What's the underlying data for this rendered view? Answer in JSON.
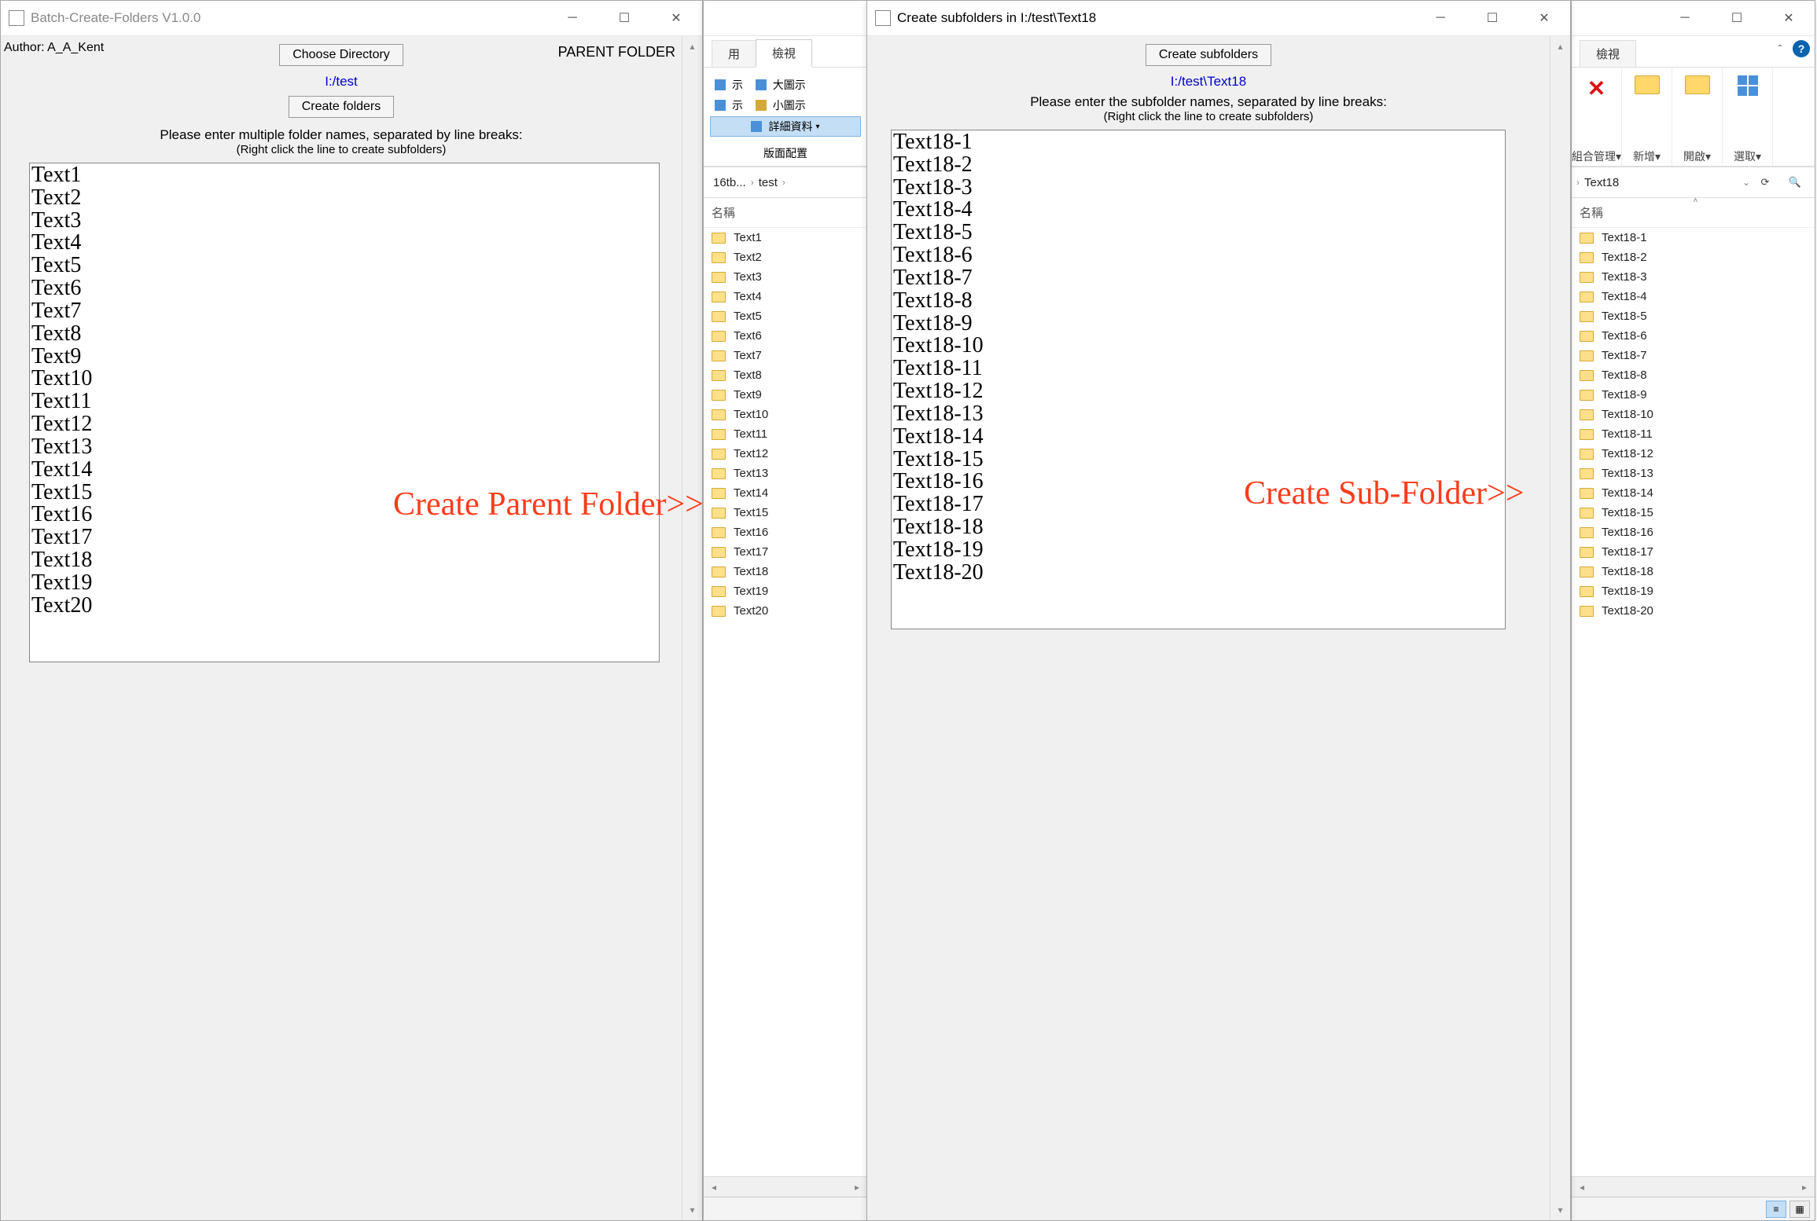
{
  "win1": {
    "title": "Batch-Create-Folders V1.0.0",
    "author": "Author: A_A_Kent",
    "parent_label": "PARENT FOLDER",
    "choose_dir": "Choose Directory",
    "path": "I:/test",
    "create_folders": "Create folders",
    "hint1": "Please enter multiple folder names, separated by line breaks:",
    "hint2": "(Right click the line to create subfolders)",
    "text": "Text1\nText2\nText3\nText4\nText5\nText6\nText7\nText8\nText9\nText10\nText11\nText12\nText13\nText14\nText15\nText16\nText17\nText18\nText19\nText20"
  },
  "win2": {
    "title": "Create subfolders in I:/test\\Text18",
    "create_sub": "Create subfolders",
    "path": "I:/test\\Text18",
    "hint1": "Please enter the subfolder names, separated by line breaks:",
    "hint2": "(Right click the line to create subfolders)",
    "text": "Text18-1\nText18-2\nText18-3\nText18-4\nText18-5\nText18-6\nText18-7\nText18-8\nText18-9\nText18-10\nText18-11\nText18-12\nText18-13\nText18-14\nText18-15\nText18-16\nText18-17\nText18-18\nText18-19\nText18-20"
  },
  "explorer1": {
    "tabs": {
      "a": "用",
      "b": "檢視"
    },
    "views": {
      "large": "大圖示",
      "small": "小圖示",
      "details": "詳細資料",
      "suffix": "示"
    },
    "panel": "版面配置",
    "bc_root": "16tb...",
    "bc_sub": "test",
    "col_name": "名稱",
    "folders": [
      "Text1",
      "Text2",
      "Text3",
      "Text4",
      "Text5",
      "Text6",
      "Text7",
      "Text8",
      "Text9",
      "Text10",
      "Text11",
      "Text12",
      "Text13",
      "Text14",
      "Text15",
      "Text16",
      "Text17",
      "Text18",
      "Text19",
      "Text20"
    ]
  },
  "explorer2": {
    "tab": "檢視",
    "rbtn": {
      "group": "組合管理",
      "new": "新增",
      "open": "開啟",
      "select": "選取"
    },
    "bc": "Text18",
    "col_name": "名稱",
    "folders": [
      "Text18-1",
      "Text18-2",
      "Text18-3",
      "Text18-4",
      "Text18-5",
      "Text18-6",
      "Text18-7",
      "Text18-8",
      "Text18-9",
      "Text18-10",
      "Text18-11",
      "Text18-12",
      "Text18-13",
      "Text18-14",
      "Text18-15",
      "Text18-16",
      "Text18-17",
      "Text18-18",
      "Text18-19",
      "Text18-20"
    ]
  },
  "annot": {
    "a": "Create Parent Folder>>",
    "b": "Create Sub-Folder>>"
  }
}
